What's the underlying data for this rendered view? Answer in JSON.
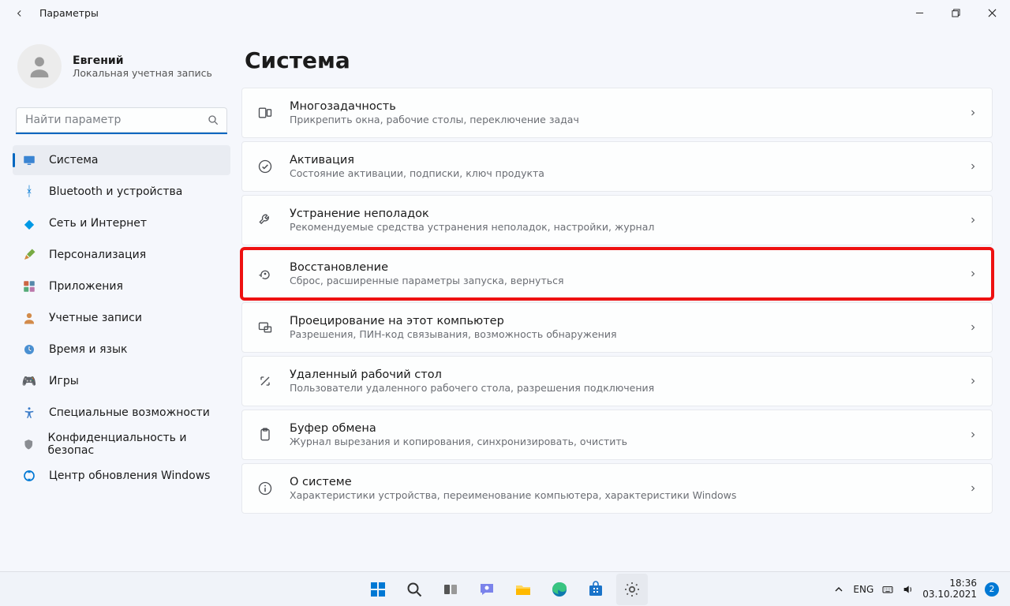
{
  "titlebar": {
    "app": "Параметры"
  },
  "user": {
    "name": "Евгений",
    "sub": "Локальная учетная запись"
  },
  "search": {
    "placeholder": "Найти параметр"
  },
  "nav": {
    "items": [
      {
        "label": "Система",
        "icon": "display-icon",
        "active": true
      },
      {
        "label": "Bluetooth и устройства",
        "icon": "bluetooth-icon",
        "active": false
      },
      {
        "label": "Сеть и Интернет",
        "icon": "wifi-icon",
        "active": false
      },
      {
        "label": "Персонализация",
        "icon": "brush-icon",
        "active": false
      },
      {
        "label": "Приложения",
        "icon": "apps-icon",
        "active": false
      },
      {
        "label": "Учетные записи",
        "icon": "accounts-icon",
        "active": false
      },
      {
        "label": "Время и язык",
        "icon": "time-icon",
        "active": false
      },
      {
        "label": "Игры",
        "icon": "games-icon",
        "active": false
      },
      {
        "label": "Специальные возможности",
        "icon": "accessibility-icon",
        "active": false
      },
      {
        "label": "Конфиденциальность и безопас",
        "icon": "privacy-icon",
        "active": false
      },
      {
        "label": "Центр обновления Windows",
        "icon": "update-icon",
        "active": false
      }
    ]
  },
  "page": {
    "title": "Система"
  },
  "cards": [
    {
      "icon": "multitask-icon",
      "title": "Многозадачность",
      "sub": "Прикрепить окна, рабочие столы, переключение задач",
      "highlight": false
    },
    {
      "icon": "check-icon",
      "title": "Активация",
      "sub": "Состояние активации, подписки, ключ продукта",
      "highlight": false
    },
    {
      "icon": "wrench-icon",
      "title": "Устранение неполадок",
      "sub": "Рекомендуемые средства устранения неполадок, настройки, журнал",
      "highlight": false
    },
    {
      "icon": "recovery-icon",
      "title": "Восстановление",
      "sub": "Сброс, расширенные параметры запуска, вернуться",
      "highlight": true
    },
    {
      "icon": "project-icon",
      "title": "Проецирование на этот компьютер",
      "sub": "Разрешения, ПИН-код связывания, возможность обнаружения",
      "highlight": false
    },
    {
      "icon": "remote-icon",
      "title": "Удаленный рабочий стол",
      "sub": "Пользователи удаленного рабочего стола, разрешения подключения",
      "highlight": false
    },
    {
      "icon": "clipboard-icon",
      "title": "Буфер обмена",
      "sub": "Журнал вырезания и копирования, синхронизировать, очистить",
      "highlight": false
    },
    {
      "icon": "info-icon",
      "title": "О системе",
      "sub": "Характеристики устройства, переименование компьютера, характеристики Windows",
      "highlight": false
    }
  ],
  "taskbar": {
    "lang": "ENG",
    "time": "18:36",
    "date": "03.10.2021",
    "notif_count": "2"
  }
}
